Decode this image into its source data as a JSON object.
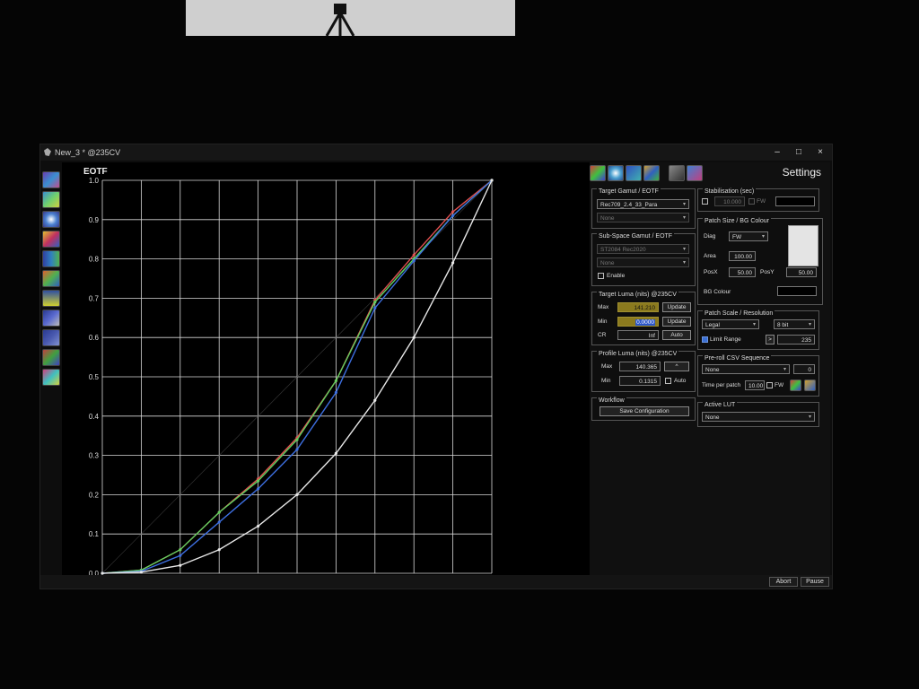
{
  "window": {
    "title": "New_3 * @235CV",
    "minimize": "–",
    "maximize": "□",
    "close": "×"
  },
  "chart": {
    "title": "EOTF"
  },
  "chart_data": {
    "type": "line",
    "title": "EOTF",
    "xlim": [
      0,
      1
    ],
    "ylim": [
      0,
      1
    ],
    "x_ticks": [
      "0.0",
      "0.1",
      "0.2",
      "0.3",
      "0.4",
      "0.5",
      "0.6",
      "0.7",
      "0.8",
      "0.9",
      "1.0"
    ],
    "y_ticks": [
      "0.0",
      "0.1",
      "0.2",
      "0.3",
      "0.4",
      "0.5",
      "0.6",
      "0.7",
      "0.8",
      "0.9",
      "1.0"
    ],
    "grid": true,
    "x": [
      0,
      0.1,
      0.2,
      0.3,
      0.4,
      0.5,
      0.6,
      0.7,
      0.8,
      0.9,
      1.0
    ],
    "series": [
      {
        "color": "#e05050",
        "values": [
          0,
          0.008,
          0.06,
          0.155,
          0.24,
          0.345,
          0.49,
          0.695,
          0.81,
          0.92,
          1.0
        ]
      },
      {
        "color": "#5fcf5f",
        "values": [
          0,
          0.008,
          0.06,
          0.155,
          0.235,
          0.34,
          0.49,
          0.69,
          0.8,
          0.91,
          1.0
        ]
      },
      {
        "color": "#3d6fe0",
        "values": [
          0,
          0.005,
          0.045,
          0.13,
          0.215,
          0.315,
          0.46,
          0.675,
          0.795,
          0.91,
          1.0
        ]
      },
      {
        "color": "#e8e8e8",
        "values": [
          0,
          0.003,
          0.02,
          0.06,
          0.12,
          0.2,
          0.305,
          0.44,
          0.6,
          0.79,
          1.0
        ]
      }
    ]
  },
  "settings": {
    "title": "Settings",
    "target_gamut": {
      "title": "Target Gamut / EOTF",
      "gamut_value": "Rec709_2.4_33_Para",
      "second_value": "None"
    },
    "sub_space": {
      "title": "Sub-Space  Gamut / EOTF",
      "gamut_value": "ST2084 Rec2020",
      "second_value": "None",
      "enable_label": "Enable"
    },
    "target_luma": {
      "title": "Target Luma (nits) @235CV",
      "max_label": "Max",
      "max_value": "141.210",
      "max_button": "Update",
      "min_label": "Min",
      "min_value": "0.0000",
      "min_button": "Update",
      "cr_label": "CR",
      "cr_value": "Inf",
      "cr_button": "Auto"
    },
    "profile_luma": {
      "title": "Profile Luma (nits) @235CV",
      "max_label": "Max",
      "max_value": "140.365",
      "max_button": "^",
      "min_label": "Min",
      "min_value": "0.1315",
      "auto_label": "Auto"
    },
    "workflow": {
      "title": "Workflow",
      "save_button": "Save Configuration"
    },
    "stabilisation": {
      "title": "Stabilisation (sec)",
      "value": "10.000",
      "fw_label": "FW"
    },
    "patch_size": {
      "title": "Patch Size / BG Colour",
      "diag_label": "Diag",
      "diag_value": "FW",
      "area_label": "Area",
      "area_value": "100.00",
      "posx_label": "PosX",
      "posx_value": "50.00",
      "posy_label": "PosY",
      "posy_value": "50.00",
      "bg_label": "BG Colour"
    },
    "patch_scale": {
      "title": "Patch Scale / Resolution",
      "scale_value": "Legal",
      "bit_value": "8 bit",
      "limit_label": "Limit Range",
      "limit_arrow": ">",
      "limit_value": "235"
    },
    "preroll": {
      "title": "Pre-roll CSV Sequence",
      "value": "None",
      "count": "0",
      "time_label": "Time per patch",
      "time_value": "10.00",
      "fw_label": "FW"
    },
    "active_lut": {
      "title": "Active LUT",
      "value": "None"
    }
  },
  "bottom": {
    "abort": "Abort",
    "pause": "Pause"
  }
}
